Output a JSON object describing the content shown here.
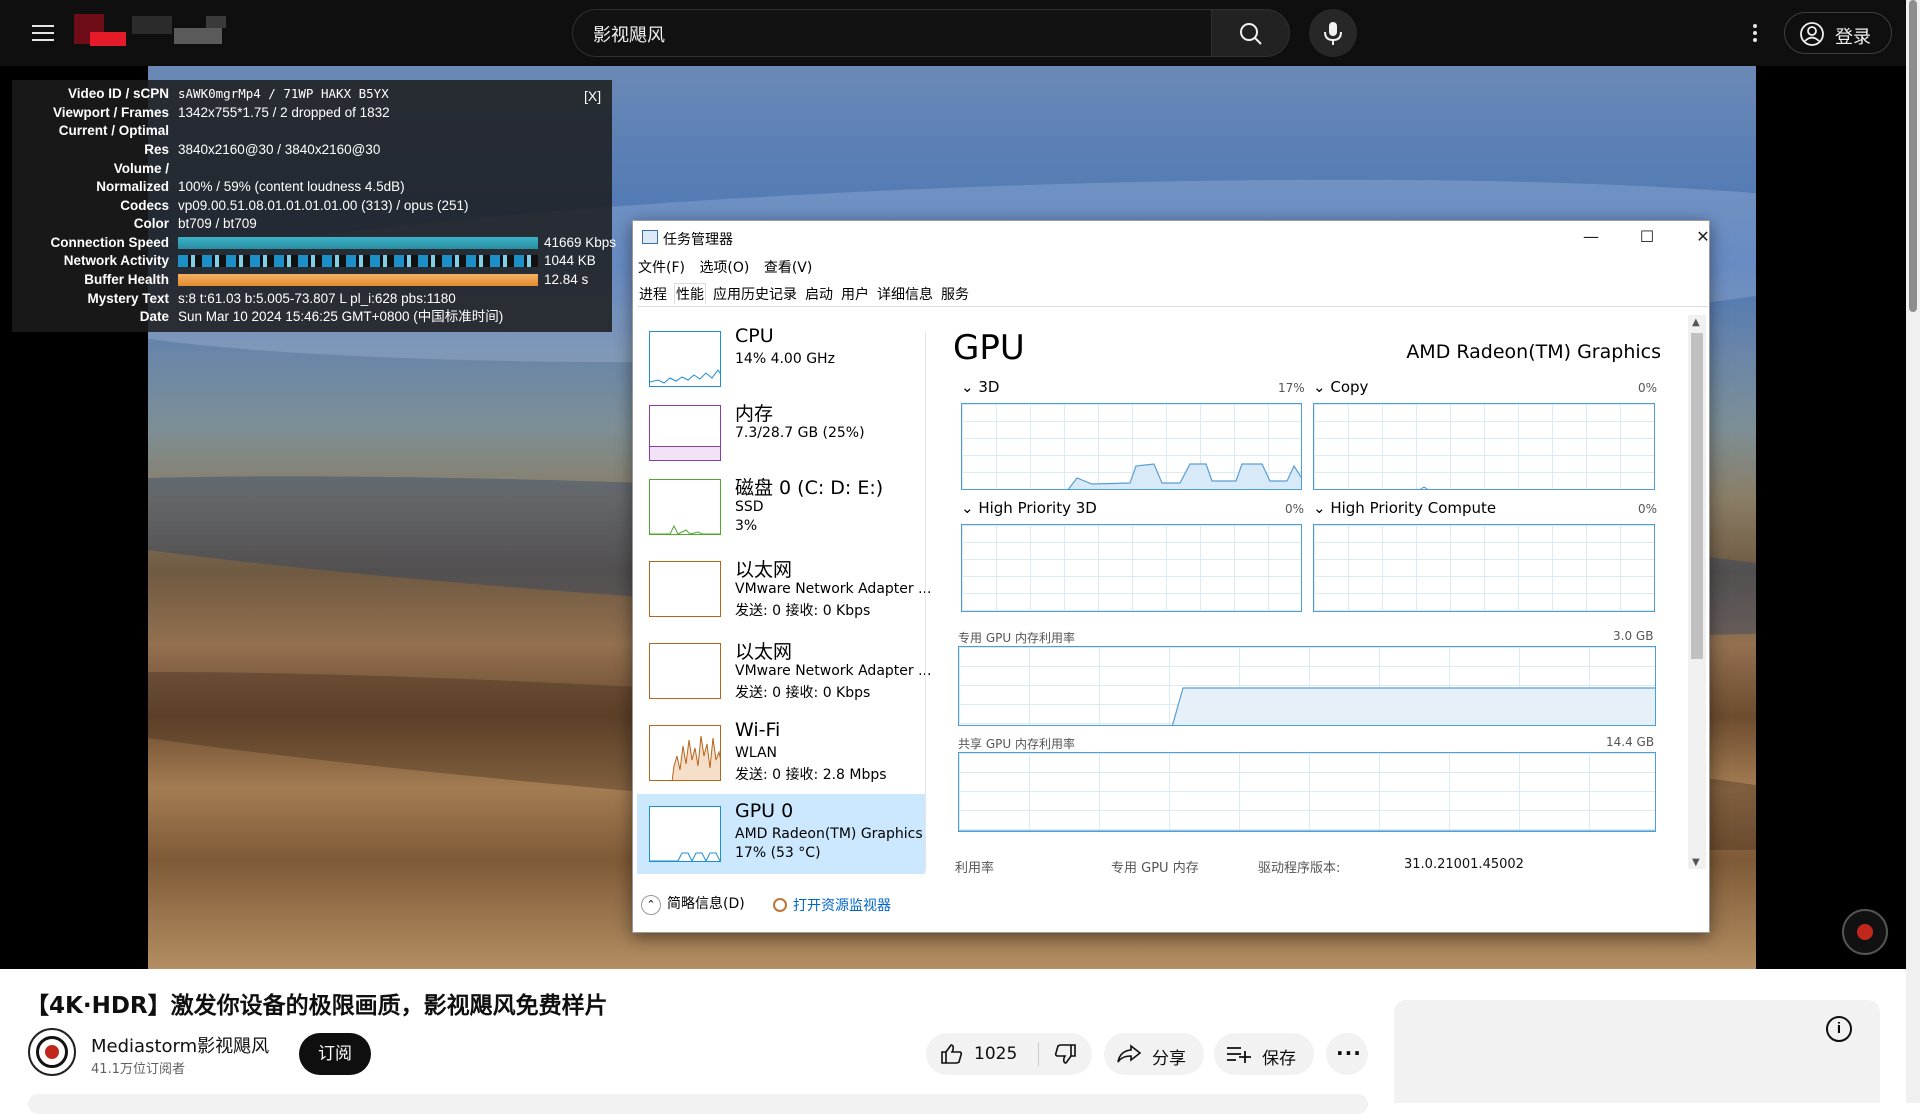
{
  "header": {
    "search_value": "影视飓风",
    "signin_label": "登录",
    "icons": [
      "menu-icon",
      "search-icon",
      "mic-icon",
      "more-vert-icon",
      "account-icon"
    ]
  },
  "stats": {
    "close_label": "[X]",
    "rows": [
      {
        "key": "Video ID / sCPN",
        "value": "sAWK0mgrMp4  /  71WP HAKX B5YX"
      },
      {
        "key": "Viewport / Frames",
        "value": "1342x755*1.75 / 2 dropped of 1832"
      },
      {
        "key": "Current / Optimal",
        "value": ""
      },
      {
        "key": "Res",
        "value": "3840x2160@30 / 3840x2160@30"
      },
      {
        "key": "Volume /",
        "value": ""
      },
      {
        "key": "Normalized",
        "value": "100% / 59% (content loudness 4.5dB)"
      },
      {
        "key": "Codecs",
        "value": "vp09.00.51.08.01.01.01.01.00 (313) / opus (251)"
      },
      {
        "key": "Color",
        "value": "bt709 / bt709"
      },
      {
        "key": "Connection Speed",
        "value": "41669 Kbps"
      },
      {
        "key": "Network Activity",
        "value": "1044 KB"
      },
      {
        "key": "Buffer Health",
        "value": "12.84 s"
      },
      {
        "key": "Mystery Text",
        "value": "s:8 t:61.03 b:5.005-73.807 L pl_i:628 pbs:1180"
      },
      {
        "key": "Date",
        "value": "Sun Mar 10 2024 15:46:25 GMT+0800 (中国标准时间)"
      }
    ],
    "colors": {
      "connection": "#3bb1c6",
      "network": "#1e90c8",
      "buffer": "#f0a14a"
    }
  },
  "taskmgr": {
    "title": "任务管理器",
    "window_buttons": [
      "—",
      "☐",
      "✕"
    ],
    "menu": [
      "文件(F)",
      "选项(O)",
      "查看(V)"
    ],
    "tabs": [
      "进程",
      "性能",
      "应用历史记录",
      "启动",
      "用户",
      "详细信息",
      "服务"
    ],
    "active_tab": "性能",
    "resources": [
      {
        "name": "CPU",
        "line2": "14%  4.00 GHz",
        "line3": "",
        "color": "#1f8cd6"
      },
      {
        "name": "内存",
        "line2": "7.3/28.7 GB (25%)",
        "line3": "",
        "color": "#8a3ca8"
      },
      {
        "name": "磁盘 0 (C: D: E:)",
        "line2": "SSD",
        "line3": "3%",
        "color": "#4ea72e"
      },
      {
        "name": "以太网",
        "line2": "VMware Network Adapter ...",
        "line3": "发送: 0  接收: 0 Kbps",
        "color": "#b5651d"
      },
      {
        "name": "以太网",
        "line2": "VMware Network Adapter ...",
        "line3": "发送: 0  接收: 0 Kbps",
        "color": "#b5651d"
      },
      {
        "name": "Wi-Fi",
        "line2": "WLAN",
        "line3": "发送: 0  接收: 2.8 Mbps",
        "color": "#b5651d"
      },
      {
        "name": "GPU 0",
        "line2": "AMD Radeon(TM) Graphics",
        "line3": "17%  (53 °C)",
        "color": "#1f8cd6"
      }
    ],
    "gpu": {
      "title": "GPU",
      "model": "AMD Radeon(TM) Graphics",
      "engines": [
        {
          "label": "3D",
          "pct": "17%"
        },
        {
          "label": "Copy",
          "pct": "0%"
        },
        {
          "label": "High Priority 3D",
          "pct": "0%"
        },
        {
          "label": "High Priority Compute",
          "pct": "0%"
        }
      ],
      "dedicated_label": "专用 GPU 内存利用率",
      "dedicated_max": "3.0 GB",
      "shared_label": "共享 GPU 内存利用率",
      "shared_max": "14.4 GB",
      "bottom": {
        "util": "利用率",
        "ded_mem": "专用 GPU 内存",
        "driver_label": "驱动程序版本:",
        "driver_value": "31.0.21001.45002"
      }
    },
    "footer": {
      "less_details": "简略信息(D)",
      "open_monitor": "打开资源监视器"
    }
  },
  "video": {
    "title": "【4K·HDR】激发你设备的极限画质，影视飓风免费样片",
    "channel": "Mediastorm影视飓风",
    "subscribers": "41.1万位订阅者",
    "subscribe_label": "订阅",
    "like_count": "1025",
    "share_label": "分享",
    "save_label": "保存"
  }
}
